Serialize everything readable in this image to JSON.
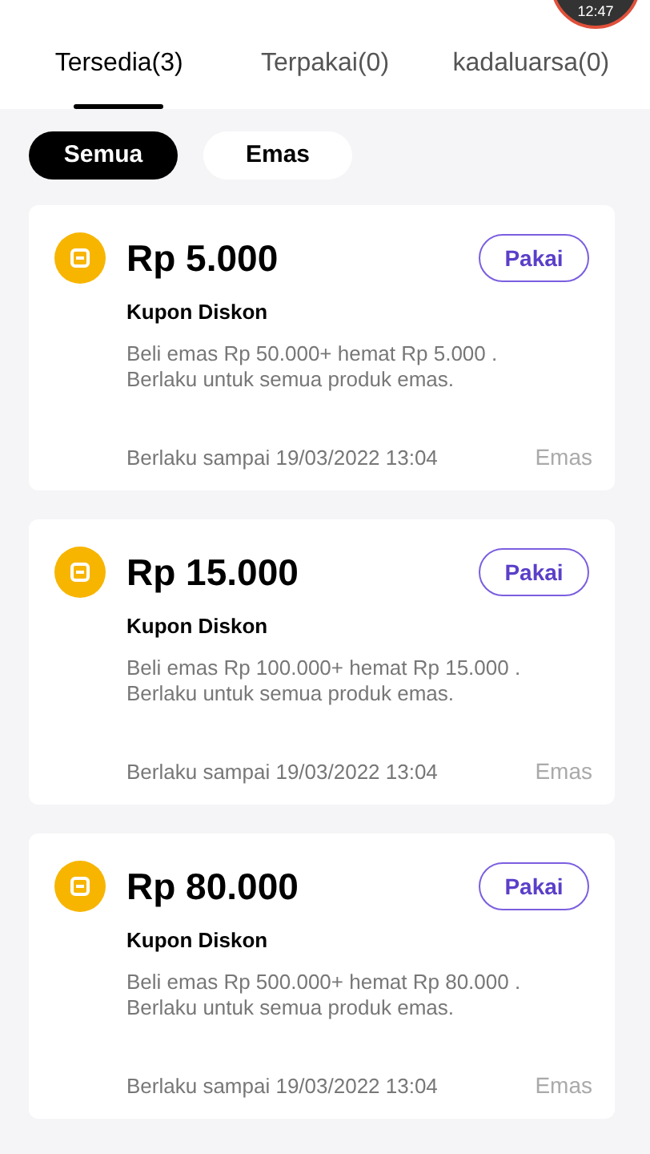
{
  "recorder_badge": {
    "time": "12:47"
  },
  "tabs": [
    {
      "label": "Tersedia(3)",
      "selected": true
    },
    {
      "label": "Terpakai(0)",
      "selected": false
    },
    {
      "label": "kadaluarsa(0)",
      "selected": false
    }
  ],
  "filters": [
    {
      "label": "Semua",
      "selected": true
    },
    {
      "label": "Emas",
      "selected": false
    }
  ],
  "coupons": [
    {
      "amount": "Rp 5.000",
      "type": "Kupon Diskon",
      "button": "Pakai",
      "description": "Beli emas Rp 50.000+ hemat Rp 5.000 . Berlaku untuk semua produk emas.",
      "validity": "Berlaku sampai 19/03/2022 13:04",
      "category": "Emas"
    },
    {
      "amount": "Rp 15.000",
      "type": "Kupon Diskon",
      "button": "Pakai",
      "description": "Beli emas Rp 100.000+ hemat Rp 15.000 . Berlaku untuk semua produk emas.",
      "validity": "Berlaku sampai 19/03/2022 13:04",
      "category": "Emas"
    },
    {
      "amount": "Rp 80.000",
      "type": "Kupon Diskon",
      "button": "Pakai",
      "description": "Beli emas Rp 500.000+ hemat Rp 80.000 . Berlaku untuk semua produk emas.",
      "validity": "Berlaku sampai 19/03/2022 13:04",
      "category": "Emas"
    }
  ]
}
